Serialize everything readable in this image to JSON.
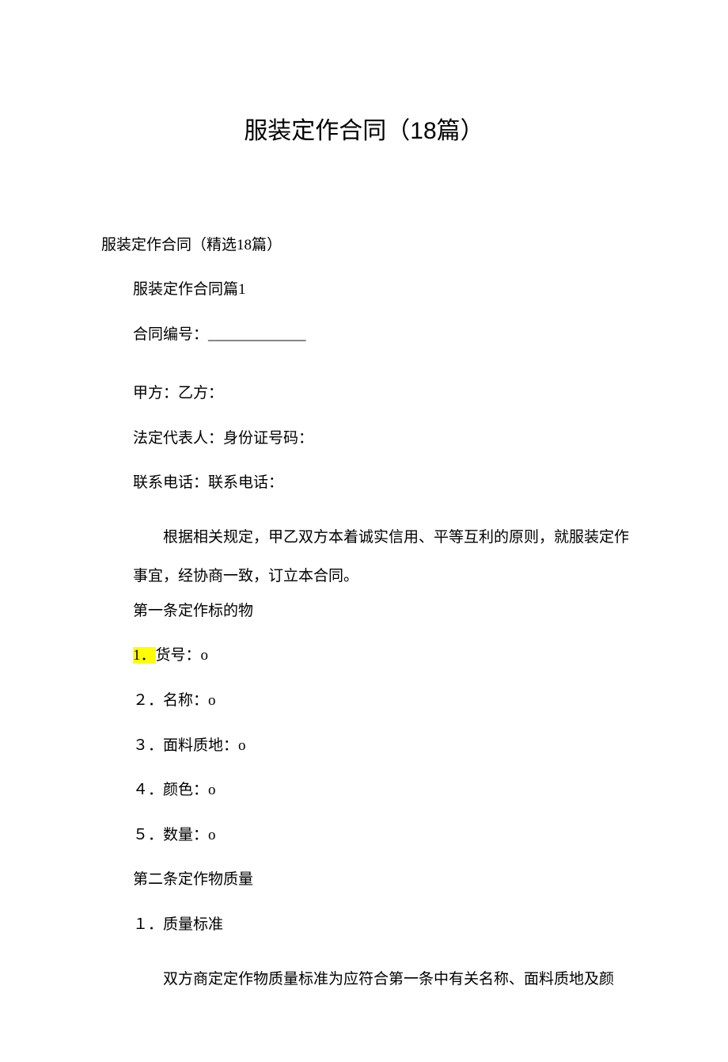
{
  "title": "服装定作合同（18篇）",
  "subtitle": "服装定作合同（精选18篇）",
  "section_heading": "服装定作合同篇1",
  "contract_no_label": "合同编号：_____________",
  "parties": "甲方：乙方：",
  "legal_rep": "法定代表人：身份证号码：",
  "phones": "联系电话：联系电话：",
  "preamble": "根据相关规定，甲乙双方本着诚实信用、平等互利的原则，就服装定作事宜，经协商一致，订立本合同。",
  "clause1_title": "第一条定作标的物",
  "item1_hl": "1．",
  "item1_txt": "货号：o",
  "item2": "２．名称：o",
  "item3": "３．面料质地：o",
  "item4": "４．颜色：o",
  "item5": "５．数量：o",
  "clause2_title": "第二条定作物质量",
  "clause2_item1": "１．质量标准",
  "clause2_body": "双方商定定作物质量标准为应符合第一条中有关名称、面料质地及颜"
}
